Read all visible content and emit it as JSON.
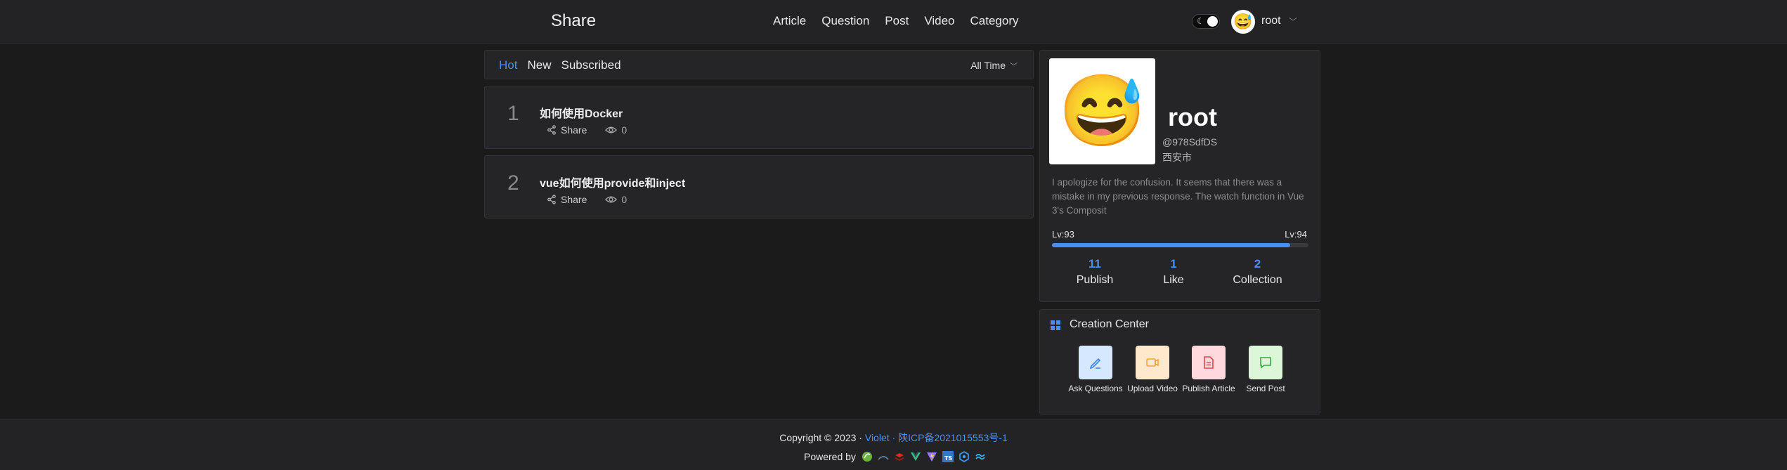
{
  "header": {
    "logo": "Share",
    "nav": [
      "Article",
      "Question",
      "Post",
      "Video",
      "Category"
    ],
    "user": "root",
    "avatar_emoji": "😅"
  },
  "filter": {
    "tabs": [
      "Hot",
      "New",
      "Subscribed"
    ],
    "active_tab": "Hot",
    "time_select": "All Time"
  },
  "posts": [
    {
      "rank": "1",
      "title": "如何使用Docker",
      "share_label": "Share",
      "views": "0"
    },
    {
      "rank": "2",
      "title": "vue如何使用provide和inject",
      "share_label": "Share",
      "views": "0"
    }
  ],
  "profile": {
    "avatar_emoji": "😅",
    "name": "root",
    "handle": "@978SdfDS",
    "city": "西安市",
    "bio": "I apologize for the confusion. It seems that there was a mistake in my previous response. The watch function in Vue 3's Composit",
    "level_current": "Lv:93",
    "level_next": "Lv:94",
    "level_progress": 0.93,
    "stats": [
      {
        "count": "11",
        "label": "Publish"
      },
      {
        "count": "1",
        "label": "Like"
      },
      {
        "count": "2",
        "label": "Collection"
      }
    ]
  },
  "creation": {
    "title": "Creation Center",
    "tools": [
      {
        "label": "Ask Questions",
        "icon": "edit-icon",
        "bg": "#d6e8ff",
        "fg": "#3a86e8"
      },
      {
        "label": "Upload Video",
        "icon": "video-icon",
        "bg": "#ffe9cc",
        "fg": "#f0a43a"
      },
      {
        "label": "Publish Article",
        "icon": "document-icon",
        "bg": "#ffd9dc",
        "fg": "#e8424f"
      },
      {
        "label": "Send Post",
        "icon": "chat-icon",
        "bg": "#dcf7d8",
        "fg": "#3aa83a"
      }
    ]
  },
  "footer": {
    "copyright": "Copyright © 2023 · ",
    "site": "Violet",
    "sep": " · ",
    "icp": "陕ICP备2021015553号-1",
    "powered": "Powered by"
  },
  "colors": {
    "accent": "#4a8ef0",
    "bg": "#1b1b1c",
    "panel": "#252527"
  }
}
